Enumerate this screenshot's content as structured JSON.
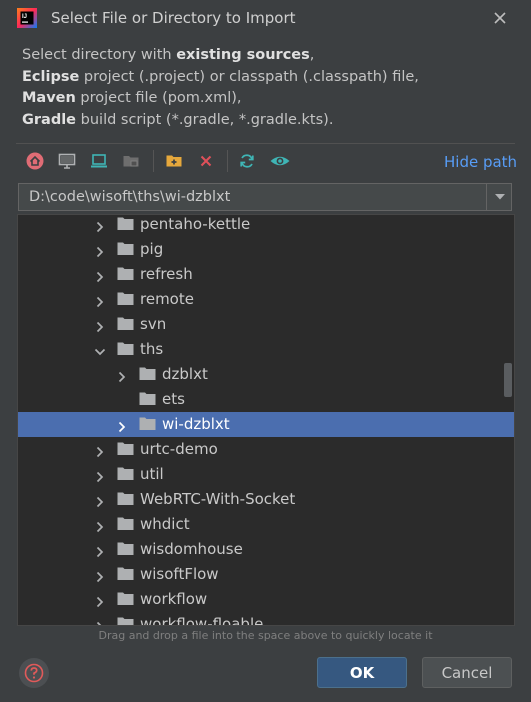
{
  "window": {
    "title": "Select File or Directory to Import",
    "app_icon": "intellij-idea-icon",
    "close_icon": "close-icon"
  },
  "description": {
    "line1_pre": "Select directory with ",
    "line1_bold": "existing sources",
    "line1_post": ",",
    "line2_bold": "Eclipse",
    "line2_post": " project (.project) or classpath (.classpath) file,",
    "line3_bold": "Maven",
    "line3_post": " project file (pom.xml),",
    "line4_bold": "Gradle",
    "line4_post": " build script (*.gradle, *.gradle.kts)."
  },
  "toolbar": {
    "buttons": [
      "home-icon",
      "desktop-icon",
      "project-icon",
      "module-icon",
      "new-folder-icon",
      "delete-icon",
      "refresh-icon",
      "show-hidden-icon"
    ],
    "hide_path_label": "Hide path"
  },
  "path": {
    "value": "D:\\code\\wisoft\\ths\\wi-dzblxt"
  },
  "tree": {
    "items": [
      {
        "label": "pentaho-kettle",
        "level": 1,
        "expanded": false
      },
      {
        "label": "pig",
        "level": 1,
        "expanded": false
      },
      {
        "label": "refresh",
        "level": 1,
        "expanded": false
      },
      {
        "label": "remote",
        "level": 1,
        "expanded": false
      },
      {
        "label": "svn",
        "level": 1,
        "expanded": false
      },
      {
        "label": "ths",
        "level": 1,
        "expanded": true
      },
      {
        "label": "dzblxt",
        "level": 2,
        "expanded": false
      },
      {
        "label": "ets",
        "level": 2,
        "expanded": false,
        "no_arrow": true
      },
      {
        "label": "wi-dzblxt",
        "level": 2,
        "expanded": false,
        "selected": true
      },
      {
        "label": "urtc-demo",
        "level": 1,
        "expanded": false
      },
      {
        "label": "util",
        "level": 1,
        "expanded": false
      },
      {
        "label": "WebRTC-With-Socket",
        "level": 1,
        "expanded": false
      },
      {
        "label": "whdict",
        "level": 1,
        "expanded": false
      },
      {
        "label": "wisdomhouse",
        "level": 1,
        "expanded": false
      },
      {
        "label": "wisoftFlow",
        "level": 1,
        "expanded": false
      },
      {
        "label": "workflow",
        "level": 1,
        "expanded": false
      },
      {
        "label": "workflow-floable",
        "level": 1,
        "expanded": false
      }
    ]
  },
  "hint": "Drag and drop a file into the space above to quickly locate it",
  "buttons": {
    "help_icon": "help-icon",
    "ok": "OK",
    "cancel": "Cancel"
  },
  "colors": {
    "background": "#3c3f41",
    "tree_background": "#2b2b2b",
    "selection": "#4b6eaf",
    "link": "#589df6",
    "ok_button": "#365880"
  }
}
